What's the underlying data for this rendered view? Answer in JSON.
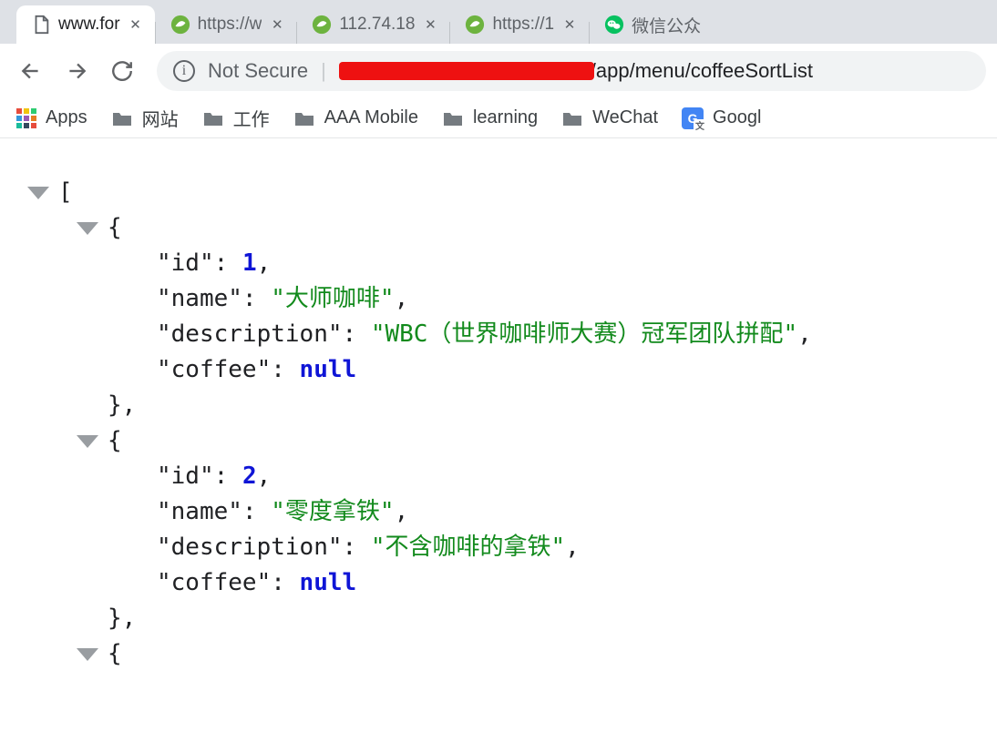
{
  "tabs": [
    {
      "title": "www.for",
      "active": true,
      "favicon": "page"
    },
    {
      "title": "https://w",
      "active": false,
      "favicon": "spring"
    },
    {
      "title": "112.74.18",
      "active": false,
      "favicon": "spring"
    },
    {
      "title": "https://1",
      "active": false,
      "favicon": "spring"
    },
    {
      "title": "微信公众",
      "active": false,
      "favicon": "wechat"
    }
  ],
  "address_bar": {
    "secure_label": "Not Secure",
    "url_tail": "/app/menu/coffeeSortList"
  },
  "bookmarks": [
    {
      "label": "Apps",
      "icon": "apps"
    },
    {
      "label": "网站",
      "icon": "folder"
    },
    {
      "label": "工作",
      "icon": "folder"
    },
    {
      "label": "AAA Mobile",
      "icon": "folder"
    },
    {
      "label": "learning",
      "icon": "folder"
    },
    {
      "label": "WeChat",
      "icon": "folder"
    },
    {
      "label": "Googl",
      "icon": "gtranslate"
    }
  ],
  "json_payload": [
    {
      "id": 1,
      "name": "大师咖啡",
      "description": "WBC（世界咖啡师大赛）冠军团队拼配",
      "coffee": null
    },
    {
      "id": 2,
      "name": "零度拿铁",
      "description": "不含咖啡的拿铁",
      "coffee": null
    }
  ],
  "json_keys": {
    "id": "id",
    "name": "name",
    "description": "description",
    "coffee": "coffee",
    "null_label": "null"
  }
}
